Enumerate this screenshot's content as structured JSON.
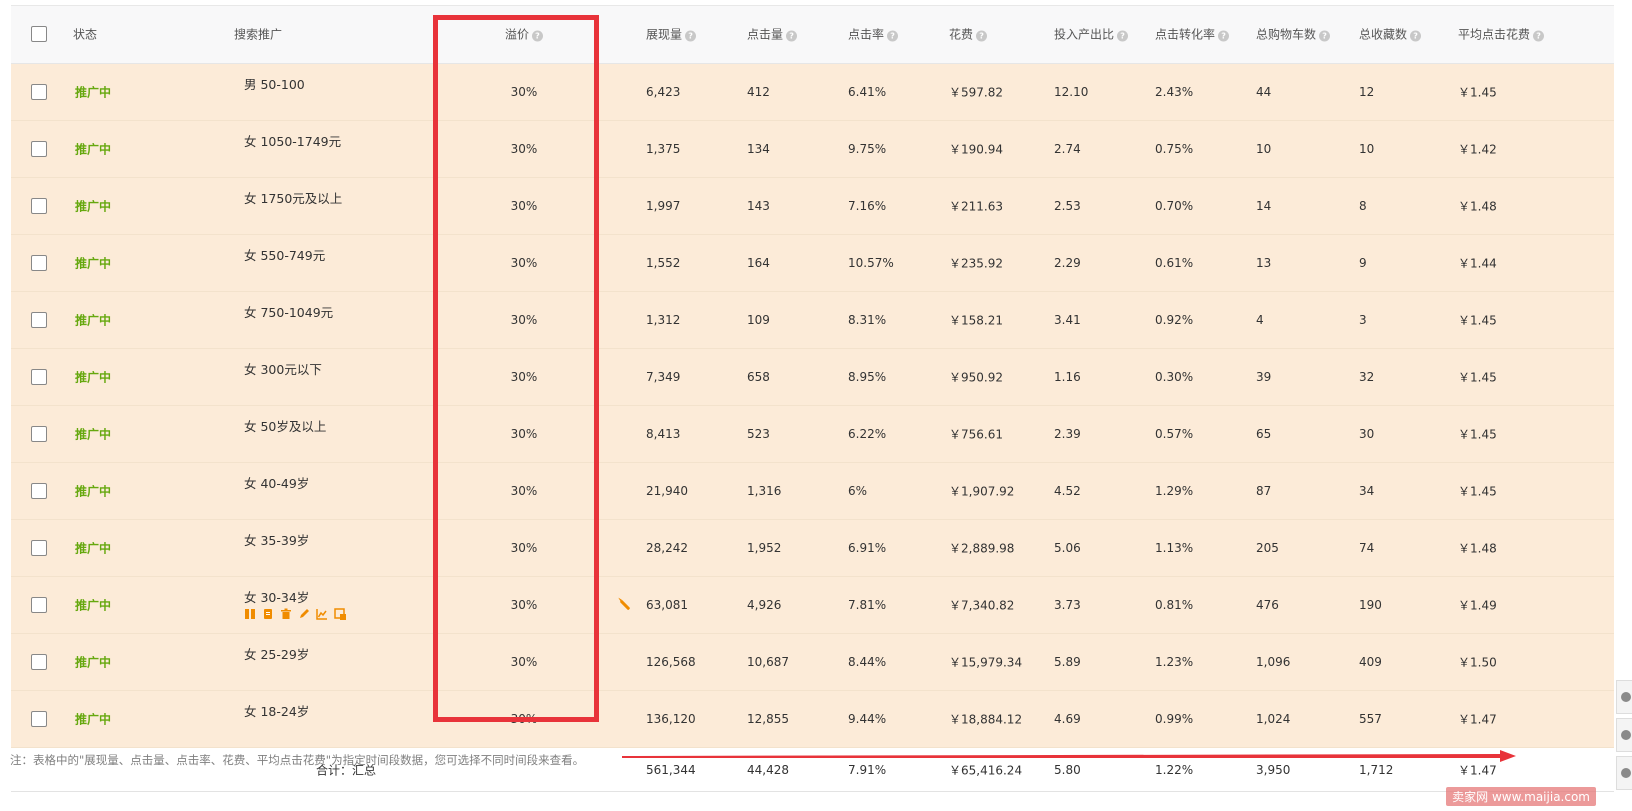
{
  "columns": {
    "status": "状态",
    "search": "搜索推广",
    "premium": "溢价",
    "impressions": "展现量",
    "clicks": "点击量",
    "ctr": "点击率",
    "cost": "花费",
    "roi": "投入产出比",
    "cvr": "点击转化率",
    "carts": "总购物车数",
    "favs": "总收藏数",
    "cpc": "平均点击花费"
  },
  "help_glyph": "?",
  "rows": [
    {
      "status": "推广中",
      "name": "男 50-100",
      "premium": "30%",
      "impressions": "6,423",
      "clicks": "412",
      "ctr": "6.41%",
      "cost": "￥597.82",
      "roi": "12.10",
      "cvr": "2.43%",
      "carts": "44",
      "favs": "12",
      "cpc": "￥1.45"
    },
    {
      "status": "推广中",
      "name": "女 1050-1749元",
      "premium": "30%",
      "impressions": "1,375",
      "clicks": "134",
      "ctr": "9.75%",
      "cost": "￥190.94",
      "roi": "2.74",
      "cvr": "0.75%",
      "carts": "10",
      "favs": "10",
      "cpc": "￥1.42"
    },
    {
      "status": "推广中",
      "name": "女 1750元及以上",
      "premium": "30%",
      "impressions": "1,997",
      "clicks": "143",
      "ctr": "7.16%",
      "cost": "￥211.63",
      "roi": "2.53",
      "cvr": "0.70%",
      "carts": "14",
      "favs": "8",
      "cpc": "￥1.48"
    },
    {
      "status": "推广中",
      "name": "女 550-749元",
      "premium": "30%",
      "impressions": "1,552",
      "clicks": "164",
      "ctr": "10.57%",
      "cost": "￥235.92",
      "roi": "2.29",
      "cvr": "0.61%",
      "carts": "13",
      "favs": "9",
      "cpc": "￥1.44"
    },
    {
      "status": "推广中",
      "name": "女 750-1049元",
      "premium": "30%",
      "impressions": "1,312",
      "clicks": "109",
      "ctr": "8.31%",
      "cost": "￥158.21",
      "roi": "3.41",
      "cvr": "0.92%",
      "carts": "4",
      "favs": "3",
      "cpc": "￥1.45"
    },
    {
      "status": "推广中",
      "name": "女 300元以下",
      "premium": "30%",
      "impressions": "7,349",
      "clicks": "658",
      "ctr": "8.95%",
      "cost": "￥950.92",
      "roi": "1.16",
      "cvr": "0.30%",
      "carts": "39",
      "favs": "32",
      "cpc": "￥1.45"
    },
    {
      "status": "推广中",
      "name": "女 50岁及以上",
      "premium": "30%",
      "impressions": "8,413",
      "clicks": "523",
      "ctr": "6.22%",
      "cost": "￥756.61",
      "roi": "2.39",
      "cvr": "0.57%",
      "carts": "65",
      "favs": "30",
      "cpc": "￥1.45"
    },
    {
      "status": "推广中",
      "name": "女 40-49岁",
      "premium": "30%",
      "impressions": "21,940",
      "clicks": "1,316",
      "ctr": "6%",
      "cost": "￥1,907.92",
      "roi": "4.52",
      "cvr": "1.29%",
      "carts": "87",
      "favs": "34",
      "cpc": "￥1.45"
    },
    {
      "status": "推广中",
      "name": "女 35-39岁",
      "premium": "30%",
      "impressions": "28,242",
      "clicks": "1,952",
      "ctr": "6.91%",
      "cost": "￥2,889.98",
      "roi": "5.06",
      "cvr": "1.13%",
      "carts": "205",
      "favs": "74",
      "cpc": "￥1.48"
    },
    {
      "status": "推广中",
      "name": "女 30-34岁",
      "premium": "30%",
      "impressions": "63,081",
      "clicks": "4,926",
      "ctr": "7.81%",
      "cost": "￥7,340.82",
      "roi": "3.73",
      "cvr": "0.81%",
      "carts": "476",
      "favs": "190",
      "cpc": "￥1.49",
      "hovered": true
    },
    {
      "status": "推广中",
      "name": "女 25-29岁",
      "premium": "30%",
      "impressions": "126,568",
      "clicks": "10,687",
      "ctr": "8.44%",
      "cost": "￥15,979.34",
      "roi": "5.89",
      "cvr": "1.23%",
      "carts": "1,096",
      "favs": "409",
      "cpc": "￥1.50"
    },
    {
      "status": "推广中",
      "name": "女 18-24岁",
      "premium": "30%",
      "impressions": "136,120",
      "clicks": "12,855",
      "ctr": "9.44%",
      "cost": "￥18,884.12",
      "roi": "4.69",
      "cvr": "0.99%",
      "carts": "1,024",
      "favs": "557",
      "cpc": "￥1.47"
    }
  ],
  "summary": {
    "label": "合计：汇总",
    "impressions": "561,344",
    "clicks": "44,428",
    "ctr": "7.91%",
    "cost": "￥65,416.24",
    "roi": "5.80",
    "cvr": "1.22%",
    "carts": "3,950",
    "favs": "1,712",
    "cpc": "￥1.47"
  },
  "footnote": "注：表格中的\"展现量、点击量、点击率、花费、平均点击花费\"为指定时间段数据，您可选择不同时间段来查看。",
  "watermark": "卖家网 www.maijia.com",
  "colors": {
    "status_green": "#66a80f",
    "highlight_red": "#e8333a",
    "row_bg": "#fcebd8",
    "action_orange": "#f08c00"
  }
}
